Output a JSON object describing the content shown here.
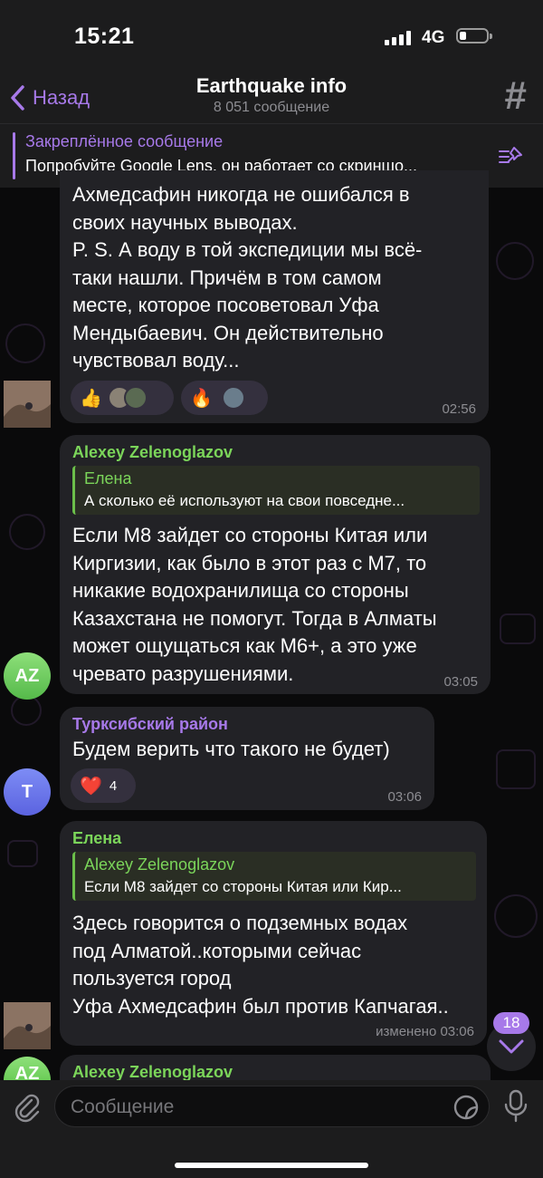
{
  "status": {
    "time": "15:21",
    "network": "4G"
  },
  "header": {
    "back_label": "Назад",
    "title": "Earthquake info",
    "subtitle": "8 051 сообщение"
  },
  "pinned": {
    "title": "Закреплённое сообщение",
    "text": "Попробуйте Google Lens, он работает со скриншо..."
  },
  "messages": [
    {
      "text_lines": [
        "Ахмедсафин никогда не ошибался в",
        "своих научных выводах.",
        "P. S. А воду в той экспедиции мы всё-",
        "таки нашли. Причём в том самом",
        "месте, которое посоветовал Уфа",
        "Мендыбаевич. Он действительно",
        "чувствовал воду..."
      ],
      "reactions": [
        "👍",
        "🔥"
      ],
      "time": "02:56"
    },
    {
      "sender": "Alexey Zelenoglazov",
      "sender_color": "#7bd55a",
      "reply_name": "Елена",
      "reply_text": "А сколько её используют на свои повседне...",
      "text_lines": [
        "Если М8 зайдет со стороны Китая или",
        "Киргизии, как было в этот раз с М7, то",
        "никакие водохранилища со стороны",
        "Казахстана не помогут. Тогда в Алматы",
        "может  ощущаться как М6+, а это уже",
        "чревато разрушениями."
      ],
      "time": "03:05",
      "avatar_initials": "AZ"
    },
    {
      "sender": "Турксибский район",
      "sender_color": "#a779e9",
      "text_lines": [
        "Будем верить что такого не будет)"
      ],
      "reaction_emoji": "❤️",
      "reaction_count": "4",
      "time": "03:06",
      "avatar_initials": "T"
    },
    {
      "sender": "Елена",
      "sender_color": "#7bd55a",
      "reply_name": "Alexey Zelenoglazov",
      "reply_text": "Если М8 зайдет со стороны Китая или Кир...",
      "text_lines": [
        "Здесь говорится о подземных водах",
        "под Алматой..которыми сейчас",
        "пользуется город",
        "Уфа Ахмедсафин был против Капчагая.."
      ],
      "time": "изменено 03:06"
    },
    {
      "sender": "Alexey Zelenoglazov",
      "avatar_initials": "AZ"
    }
  ],
  "scroll": {
    "unread_count": "18"
  },
  "input": {
    "placeholder": "Сообщение"
  },
  "colors": {
    "accent": "#a779e9",
    "green_name": "#7bd55a",
    "bubble": "#222226",
    "bar": "#1c1c1d"
  },
  "icons": [
    "back-chevron-icon",
    "hashtag-icon",
    "pin-list-icon",
    "scroll-down-icon",
    "attach-icon",
    "sticker-icon",
    "microphone-icon"
  ]
}
